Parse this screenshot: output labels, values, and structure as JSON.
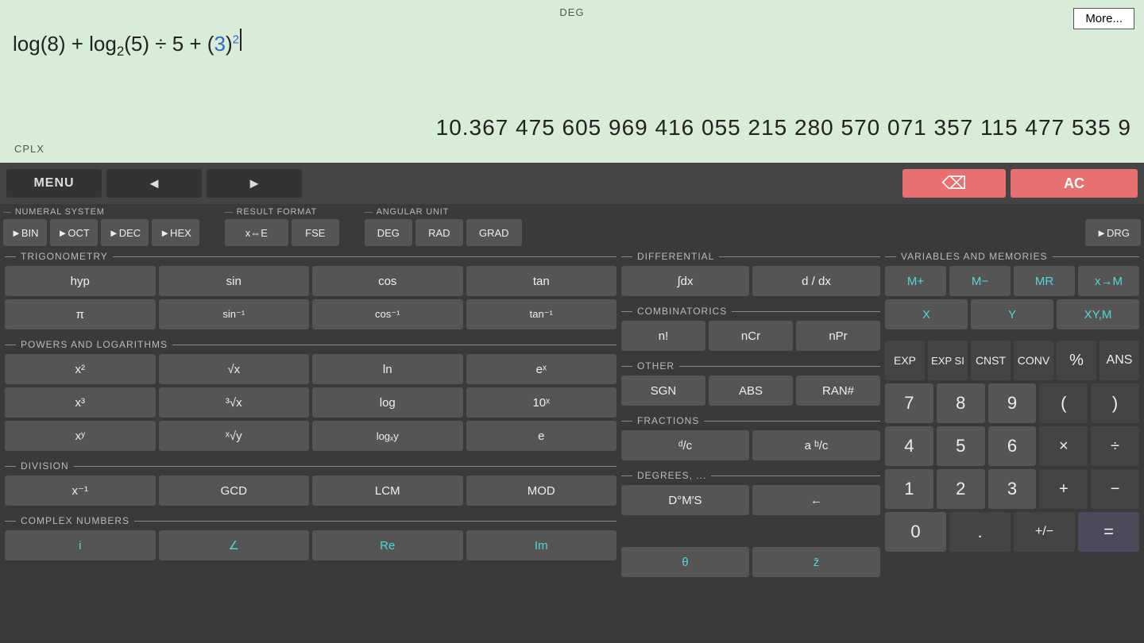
{
  "display": {
    "deg_label": "DEG",
    "cplx_label": "CPLX",
    "more_btn": "More...",
    "expression": "log(8) + log₂(5) ÷ 5 + (3)²",
    "result": "10.367 475 605 969 416 055 215 280 570 071 357 115 477 535 9"
  },
  "controls": {
    "menu": "MENU",
    "left_arrow": "◄",
    "right_arrow": "►",
    "backspace": "⌫",
    "ac": "AC"
  },
  "numeral_system": {
    "label": "NUMERAL SYSTEM",
    "bin": "►BIN",
    "oct": "►OCT",
    "dec": "►DEC",
    "hex": "►HEX"
  },
  "result_format": {
    "label": "RESULT FORMAT",
    "xe": "x⇔E",
    "fse": "FSE"
  },
  "angular_unit": {
    "label": "ANGULAR UNIT",
    "deg": "DEG",
    "rad": "RAD",
    "grad": "GRAD",
    "drg": "►DRG"
  },
  "trigonometry": {
    "label": "TRIGONOMETRY",
    "hyp": "hyp",
    "sin": "sin",
    "cos": "cos",
    "tan": "tan",
    "pi": "π",
    "sin_inv": "sin⁻¹",
    "cos_inv": "cos⁻¹",
    "tan_inv": "tan⁻¹"
  },
  "differential": {
    "label": "DIFFERENTIAL",
    "int_dx": "∫dx",
    "d_dx": "d / dx"
  },
  "variables": {
    "label": "VARIABLES AND MEMORIES",
    "mplus": "M+",
    "mminus": "M−",
    "mr": "MR",
    "xm": "x→M",
    "x": "X",
    "y": "Y",
    "xym": "XY,M"
  },
  "combinatorics": {
    "label": "COMBINATORICS",
    "nfact": "n!",
    "ncr": "nCr",
    "npr": "nPr"
  },
  "powers": {
    "label": "POWERS AND LOGARITHMS",
    "x2": "x²",
    "sqrt": "√x",
    "ln": "ln",
    "ex": "eˣ",
    "x3": "x³",
    "cbrt": "³√x",
    "log": "log",
    "pow10": "10ˣ",
    "xy": "xʸ",
    "yrtx": "ˣ√y",
    "logxy": "logₓy",
    "e": "e"
  },
  "other": {
    "label": "OTHER",
    "sgn": "SGN",
    "abs": "ABS",
    "ran": "RAN#"
  },
  "fractions": {
    "label": "FRACTIONS",
    "dc": "ᵈ/c",
    "abdc": "a ᵇ/c"
  },
  "division": {
    "label": "DIVISION",
    "xinv": "x⁻¹",
    "gcd": "GCD",
    "lcm": "LCM",
    "mod": "MOD"
  },
  "degrees": {
    "label": "DEGREES, ...",
    "dms": "D°M′S",
    "back": "←"
  },
  "complex": {
    "label": "COMPLEX NUMBERS",
    "i": "i",
    "angle": "∠",
    "re": "Re",
    "im": "Im",
    "theta": "θ",
    "zbar": "z̄"
  },
  "numpad": {
    "top_row": [
      "EXP",
      "EXP SI",
      "CNST",
      "CONV",
      "%",
      "ANS"
    ],
    "row7": [
      "7",
      "8",
      "9",
      "(",
      ")"
    ],
    "row4": [
      "4",
      "5",
      "6",
      "×",
      "÷"
    ],
    "row1": [
      "1",
      "2",
      "3",
      "+",
      "−"
    ],
    "row0": [
      "0",
      ".",
      "+/−",
      "="
    ]
  }
}
